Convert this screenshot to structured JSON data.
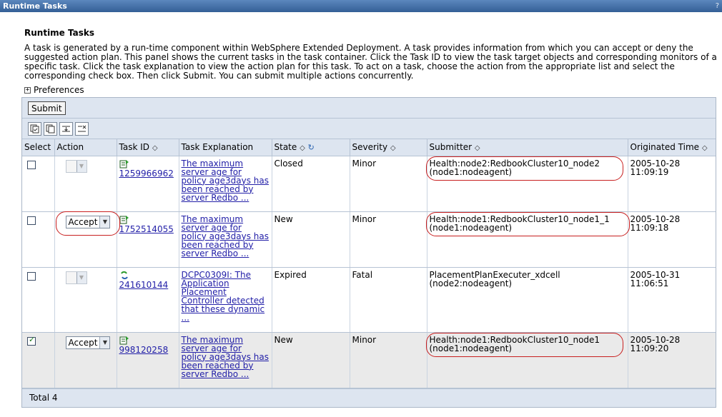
{
  "window": {
    "title": "Runtime Tasks",
    "help": "?"
  },
  "page": {
    "heading": "Runtime Tasks",
    "description": "A task is generated by a run-time component within WebSphere Extended Deployment. A task provides information from which you can accept or deny the suggested action plan. This panel shows the current tasks in the task container. Click the Task ID to view the task target objects and corresponding monitors of a specific task. Click the task explanation to view the action plan for this task. To act on a task, choose the action from the appropriate list and select the corresponding check box. Then click Submit. You can submit multiple actions concurrently.",
    "preferences": "Preferences"
  },
  "toolbar": {
    "submit_label": "Submit"
  },
  "icons": [
    "select-all-icon",
    "deselect-all-icon",
    "show-filter-icon",
    "clear-filter-icon"
  ],
  "columns": {
    "select": "Select",
    "action": "Action",
    "task_id": "Task ID",
    "explanation": "Task Explanation",
    "state": "State",
    "severity": "Severity",
    "submitter": "Submitter",
    "originated": "Originated Time"
  },
  "rows": [
    {
      "checked": false,
      "action": "",
      "action_enabled": false,
      "icon": "task-running-icon",
      "task_id": "1259966962",
      "explanation": "The maximum server age for policy age3days has been reached by server Redbo ...",
      "state": "Closed",
      "severity": "Minor",
      "submitter": "Health:node2:RedbookCluster10_node2 (node1:nodeagent)",
      "originated": "2005-10-28 11:09:19"
    },
    {
      "checked": false,
      "action": "Accept",
      "action_enabled": true,
      "icon": "task-running-icon",
      "task_id": "1752514055",
      "explanation": "The maximum server age for policy age3days has been reached by server Redbo ...",
      "state": "New",
      "severity": "Minor",
      "submitter": "Health:node1:RedbookCluster10_node1_1 (node1:nodeagent)",
      "originated": "2005-10-28 11:09:18"
    },
    {
      "checked": false,
      "action": "",
      "action_enabled": false,
      "icon": "task-expired-icon",
      "task_id": "241610144",
      "explanation": "DCPC0309I: The Application Placement Controller detected that these dynamic ...",
      "state": "Expired",
      "severity": "Fatal",
      "submitter": "PlacementPlanExecuter_xdcell (node2:nodeagent)",
      "originated": "2005-10-31 11:06:51"
    },
    {
      "checked": true,
      "action": "Accept",
      "action_enabled": true,
      "icon": "task-running-icon",
      "task_id": "998120258",
      "explanation": "The maximum server age for policy age3days has been reached by server Redbo ...",
      "state": "New",
      "severity": "Minor",
      "submitter": "Health:node1:RedbookCluster10_node1 (node1:nodeagent)",
      "originated": "2005-10-28 11:09:20"
    }
  ],
  "footer": {
    "total": "Total 4"
  },
  "colors": {
    "header_bg": "#dde5f0",
    "title_bar": "#3e6ea8",
    "link": "#2320a8",
    "annotation": "#c82020"
  }
}
